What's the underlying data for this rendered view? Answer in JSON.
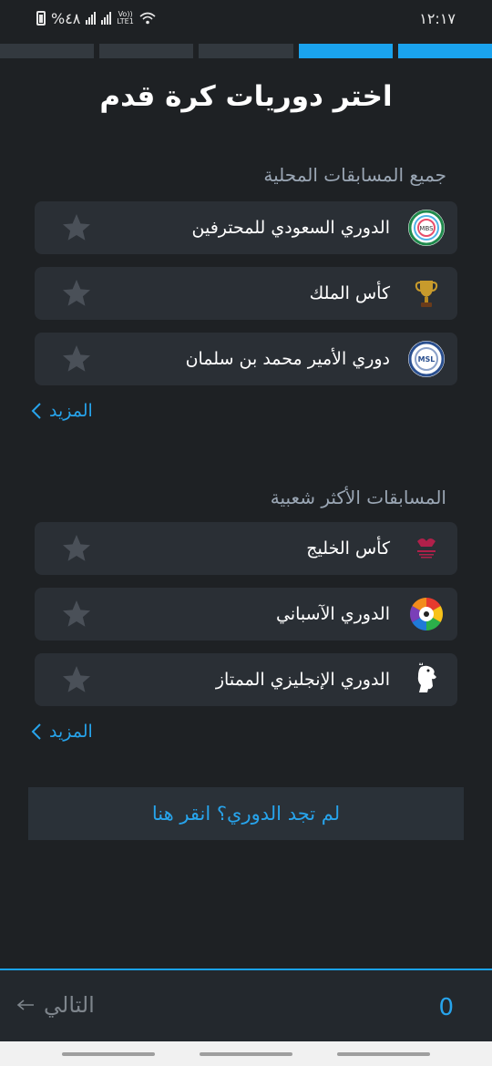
{
  "status_bar": {
    "time": "١٢:١٧",
    "battery": "%٤٨",
    "volte_top": "Vo))",
    "volte_bottom": "LTE1"
  },
  "progress": {
    "total_steps": 5,
    "completed_steps": 2
  },
  "page_title": "اختر دوريات كرة قدم",
  "sections": {
    "local": {
      "title": "جميع المسابقات المحلية",
      "items": [
        {
          "label": "الدوري السعودي للمحترفين",
          "icon": "saudi-pro-league-icon",
          "logo_text": "MBS"
        },
        {
          "label": "كأس الملك",
          "icon": "kings-cup-trophy-icon",
          "logo_text": ""
        },
        {
          "label": "دوري الأمير محمد بن سلمان",
          "icon": "msl-league-icon",
          "logo_text": "MSL"
        }
      ],
      "more_label": "المزيد"
    },
    "popular": {
      "title": "المسابقات الأكثر شعبية",
      "items": [
        {
          "label": "كأس الخليج",
          "icon": "gulf-cup-icon",
          "logo_text": ""
        },
        {
          "label": "الدوري الآسباني",
          "icon": "laliga-icon",
          "logo_text": ""
        },
        {
          "label": "الدوري الإنجليزي الممتاز",
          "icon": "premier-league-icon",
          "logo_text": ""
        }
      ],
      "more_label": "المزيد"
    }
  },
  "cta_label": "لم تجد الدوري؟ انقر هنا",
  "footer": {
    "next_label": "التالي",
    "selected_count": "0"
  },
  "colors": {
    "background": "#1e2124",
    "card": "#2a2f35",
    "accent": "#1aa3ee",
    "link": "#27a4ec",
    "muted_text": "#9aa6b4",
    "star": "#4a5058"
  }
}
